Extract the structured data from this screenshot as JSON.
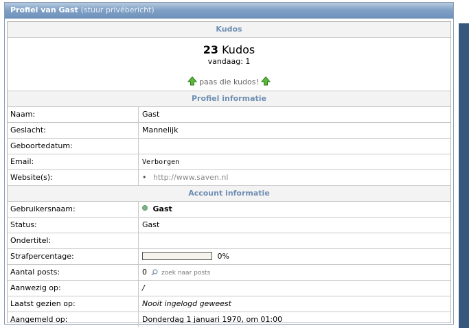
{
  "panel": {
    "title": "Profiel van Gast",
    "subtitle": "(stuur privébericht)"
  },
  "kudos": {
    "header": "Kudos",
    "count": "23",
    "label": "Kudos",
    "today": "vandaag: 1",
    "pass_text": "paas die kudos!",
    "arrow_icon": "green-up-arrow-icon"
  },
  "profile": {
    "header": "Profiel informatie",
    "rows": [
      {
        "label": "Naam:",
        "value": "Gast"
      },
      {
        "label": "Geslacht:",
        "value": "Mannelijk"
      },
      {
        "label": "Geboortedatum:",
        "value": ""
      },
      {
        "label": "Email:",
        "value": "Verborgen"
      },
      {
        "label": "Website(s):",
        "value": "http://www.saven.nl"
      }
    ]
  },
  "account": {
    "header": "Account informatie",
    "rows": [
      {
        "label": "Gebruikersnaam:",
        "value": "Gast"
      },
      {
        "label": "Status:",
        "value": "Gast"
      },
      {
        "label": "Ondertitel:",
        "value": ""
      },
      {
        "label": "Strafpercentage:",
        "value": "0%"
      },
      {
        "label": "Aantal posts:",
        "value": "0",
        "extra": "zoek naar posts"
      },
      {
        "label": "Aanwezig op:",
        "value": "/"
      },
      {
        "label": "Laatst gezien op:",
        "value": "Nooit ingelogd geweest"
      },
      {
        "label": "Aangemeld op:",
        "value": "Donderdag 1 januari 1970, om 01:00"
      }
    ]
  },
  "strafpercentage_fraction": 0,
  "colors": {
    "title_bar": "#7f9fc4",
    "section_head_text": "#6f8fb3",
    "online_dot": "#7fb38a",
    "side_strip": "#36587e"
  }
}
